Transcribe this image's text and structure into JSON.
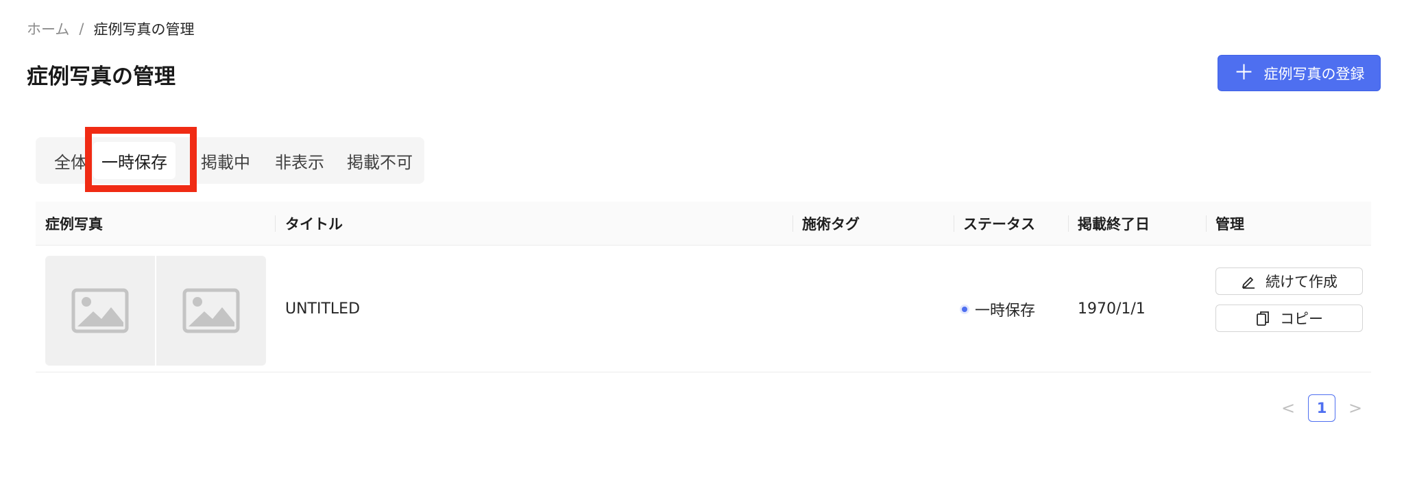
{
  "breadcrumb": {
    "home": "ホーム",
    "separator": "/",
    "current": "症例写真の管理"
  },
  "header": {
    "title": "症例写真の管理",
    "register_button": "症例写真の登録"
  },
  "tabs": [
    {
      "label": "全体",
      "active": false
    },
    {
      "label": "一時保存",
      "active": true
    },
    {
      "label": "掲載中",
      "active": false
    },
    {
      "label": "非表示",
      "active": false
    },
    {
      "label": "掲載不可",
      "active": false
    }
  ],
  "table": {
    "columns": [
      "症例写真",
      "タイトル",
      "施術タグ",
      "ステータス",
      "掲載終了日",
      "管理"
    ],
    "rows": [
      {
        "title": "UNTITLED",
        "tags": "",
        "status": "一時保存",
        "end_date": "1970/1/1",
        "actions": {
          "continue": "続けて作成",
          "copy": "コピー"
        }
      }
    ]
  },
  "pagination": {
    "current_page": "1",
    "prev": "<",
    "next": ">"
  },
  "colors": {
    "primary": "#4e6ff0",
    "highlight": "#f02b14"
  },
  "icons": [
    "plus-icon",
    "image-placeholder-icon",
    "pencil-icon",
    "copy-icon",
    "chevron-left-icon",
    "chevron-right-icon"
  ]
}
